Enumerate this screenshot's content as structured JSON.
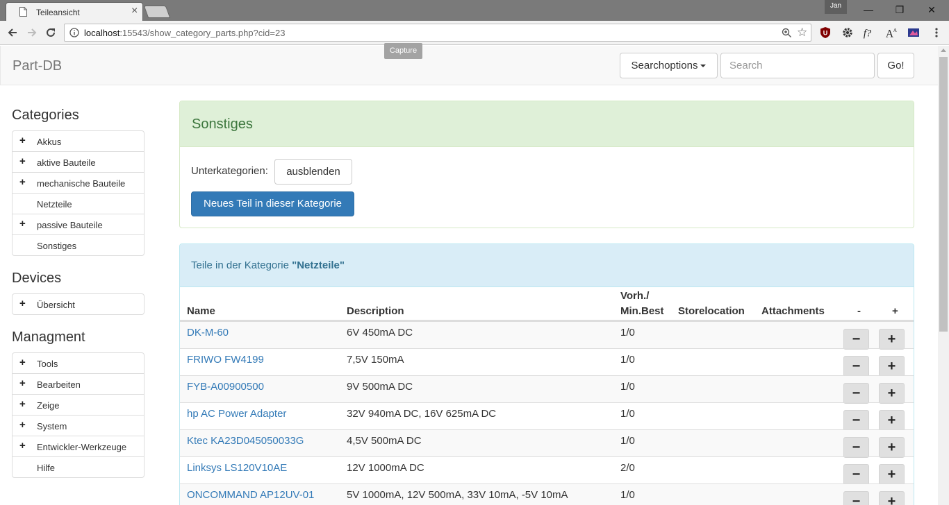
{
  "browser": {
    "tab_title": "Teileansicht",
    "tab_close": "×",
    "user": "Jan",
    "url_host": "localhost",
    "url_rest": ":15543/show_category_parts.php?cid=23",
    "tooltip": "Capture",
    "window_controls": [
      "—",
      "❐",
      "✕"
    ]
  },
  "navbar": {
    "brand": "Part-DB",
    "searchoptions_label": "Searchoptions",
    "search_placeholder": "Search",
    "go_label": "Go!"
  },
  "sidebar": {
    "categories_heading": "Categories",
    "categories": [
      {
        "label": "Akkus",
        "expandable": true
      },
      {
        "label": "aktive Bauteile",
        "expandable": true
      },
      {
        "label": "mechanische Bauteile",
        "expandable": true
      },
      {
        "label": "Netzteile",
        "expandable": false
      },
      {
        "label": "passive Bauteile",
        "expandable": true
      },
      {
        "label": "Sonstiges",
        "expandable": false
      }
    ],
    "devices_heading": "Devices",
    "devices": [
      {
        "label": "Übersicht",
        "expandable": true
      }
    ],
    "management_heading": "Managment",
    "management": [
      {
        "label": "Tools",
        "expandable": true
      },
      {
        "label": "Bearbeiten",
        "expandable": true
      },
      {
        "label": "Zeige",
        "expandable": true
      },
      {
        "label": "System",
        "expandable": true
      },
      {
        "label": "Entwickler-Werkzeuge",
        "expandable": true
      },
      {
        "label": "Hilfe",
        "expandable": false
      }
    ],
    "plus_glyph": "+"
  },
  "category_panel": {
    "title": "Sonstiges",
    "subcategories_label": "Unterkategorien:",
    "hide_button": "ausblenden",
    "new_part_button": "Neues Teil in dieser Kategorie"
  },
  "parts_panel": {
    "title_prefix": "Teile in der Kategorie ",
    "title_category": "\"Netzteile\"",
    "columns": {
      "name": "Name",
      "description": "Description",
      "stock_line1": "Vorh./",
      "stock_line2": "Min.Best",
      "storelocation": "Storelocation",
      "attachments": "Attachments",
      "minus": "-",
      "plus": "+"
    },
    "minus_glyph": "−",
    "plus_glyph": "+",
    "rows": [
      {
        "name": "DK-M-60",
        "description": "6V 450mA DC",
        "stock": "1/0"
      },
      {
        "name": "FRIWO FW4199",
        "description": "7,5V 150mA",
        "stock": "1/0"
      },
      {
        "name": "FYB-A00900500",
        "description": "9V 500mA DC",
        "stock": "1/0"
      },
      {
        "name": "hp AC Power Adapter",
        "description": "32V 940mA DC, 16V 625mA DC",
        "stock": "1/0"
      },
      {
        "name": "Ktec KA23D045050033G",
        "description": "4,5V 500mA DC",
        "stock": "1/0"
      },
      {
        "name": "Linksys LS120V10AE",
        "description": "12V 1000mA DC",
        "stock": "2/0"
      },
      {
        "name": "ONCOMMAND AP12UV-01",
        "description": "5V 1000mA, 12V 500mA, 33V 10mA, -5V 10mA",
        "stock": "1/0"
      }
    ]
  }
}
